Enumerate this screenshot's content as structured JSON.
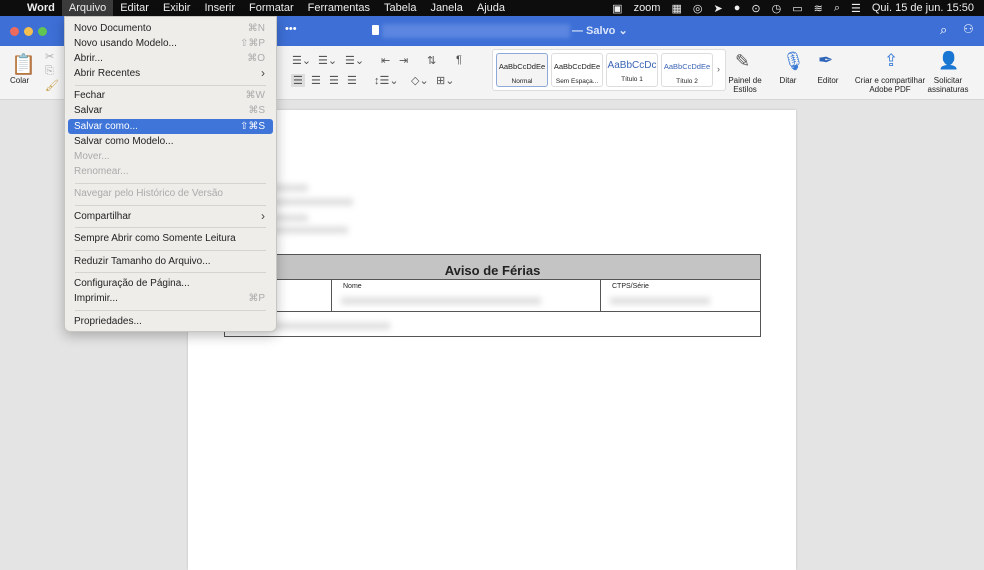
{
  "menubar": {
    "apple": "",
    "items": [
      "Word",
      "Arquivo",
      "Editar",
      "Exibir",
      "Inserir",
      "Formatar",
      "Ferramentas",
      "Tabela",
      "Janela",
      "Ajuda"
    ],
    "status_zoom": "zoom",
    "clock": "Qui. 15 de jun.  15:50"
  },
  "titlebar": {
    "more": "•••",
    "saved": "— Salvo ⌄"
  },
  "ribbon": {
    "paste": "Colar",
    "styles": [
      {
        "sample": "AaBbCcDdEe",
        "label": "Normal"
      },
      {
        "sample": "AaBbCcDdEe",
        "label": "Sem Espaça..."
      },
      {
        "sample": "AaBbCcDc",
        "label": "Título 1"
      },
      {
        "sample": "AaBbCcDdEe",
        "label": "Título 2"
      }
    ],
    "styles_pane": "Painel de Estilos",
    "dictate": "Ditar",
    "editor": "Editor",
    "adobe": "Criar e compartilhar Adobe PDF",
    "sign": "Solicitar assinaturas"
  },
  "document": {
    "table_title": "Aviso de Férias",
    "col_nome": "Nome",
    "col_ctps": "CTPS/Série"
  },
  "menu": {
    "items": [
      {
        "label": "Novo Documento",
        "shortcut": "⌘N"
      },
      {
        "label": "Novo usando Modelo...",
        "shortcut": "⇧⌘P"
      },
      {
        "label": "Abrir...",
        "shortcut": "⌘O"
      },
      {
        "label": "Abrir Recentes",
        "shortcut": "›"
      },
      {
        "label": "Fechar",
        "shortcut": "⌘W"
      },
      {
        "label": "Salvar",
        "shortcut": "⌘S"
      },
      {
        "label": "Salvar como...",
        "shortcut": "⇧⌘S"
      },
      {
        "label": "Salvar como Modelo...",
        "shortcut": ""
      },
      {
        "label": "Mover...",
        "shortcut": ""
      },
      {
        "label": "Renomear...",
        "shortcut": ""
      },
      {
        "label": "Navegar pelo Histórico de Versão",
        "shortcut": ""
      },
      {
        "label": "Compartilhar",
        "shortcut": "›"
      },
      {
        "label": "Sempre Abrir como Somente Leitura",
        "shortcut": ""
      },
      {
        "label": "Reduzir Tamanho do Arquivo...",
        "shortcut": ""
      },
      {
        "label": "Configuração de Página...",
        "shortcut": ""
      },
      {
        "label": "Imprimir...",
        "shortcut": "⌘P"
      },
      {
        "label": "Propriedades...",
        "shortcut": ""
      }
    ]
  }
}
